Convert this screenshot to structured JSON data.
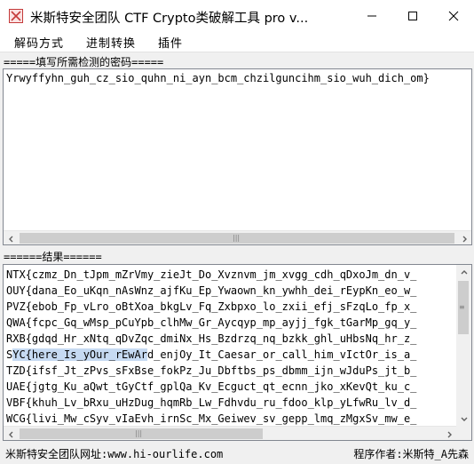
{
  "window": {
    "title": "米斯特安全团队 CTF Crypto类破解工具 pro v..."
  },
  "menu": {
    "items": [
      "解码方式",
      "进制转换",
      "插件"
    ]
  },
  "input_section": {
    "label": "=====填写所需检测的密码=====",
    "value": "Yrwyffyhn_guh_cz_sio_quhn_ni_ayn_bcm_chzilguncihm_sio_wuh_dich_om}"
  },
  "result_section": {
    "label": "======结果======",
    "lines": [
      {
        "pre": "NTX",
        "sel": "",
        "post": "{czmz_Dn_tJpm_mZrVmy_zieJt_Do_Xvznvm_jm_xvgg_cdh_qDxoJm_dn_v_"
      },
      {
        "pre": "OUY",
        "sel": "",
        "post": "{dana_Eo_uKqn_nAsWnz_ajfKu_Ep_Ywaown_kn_ywhh_dei_rEypKn_eo_w_"
      },
      {
        "pre": "PVZ",
        "sel": "",
        "post": "{ebob_Fp_vLro_oBtXoa_bkgLv_Fq_Zxbpxo_lo_zxii_efj_sFzqLo_fp_x_"
      },
      {
        "pre": "QWA",
        "sel": "",
        "post": "{fcpc_Gq_wMsp_pCuYpb_clhMw_Gr_Aycqyp_mp_ayjj_fgk_tGarMp_gq_y_"
      },
      {
        "pre": "RXB",
        "sel": "",
        "post": "{gdqd_Hr_xNtq_qDvZqc_dmiNx_Hs_Bzdrzq_nq_bzkk_ghl_uHbsNq_hr_z_"
      },
      {
        "pre": "S",
        "sel": "YC{here_Is_yOur_rEwAr",
        "post": "d_enjOy_It_Caesar_or_call_him_vIctOr_is_a_"
      },
      {
        "pre": "TZD",
        "sel": "",
        "post": "{ifsf_Jt_zPvs_sFxBse_fokPz_Ju_Dbftbs_ps_dbmm_ijn_wJduPs_jt_b_"
      },
      {
        "pre": "UAE",
        "sel": "",
        "post": "{jgtg_Ku_aQwt_tGyCtf_gplQa_Kv_Ecguct_qt_ecnn_jko_xKevQt_ku_c_"
      },
      {
        "pre": "VBF",
        "sel": "",
        "post": "{khuh_Lv_bRxu_uHzDug_hqmRb_Lw_Fdhvdu_ru_fdoo_klp_yLfwRu_lv_d_"
      },
      {
        "pre": "WCG",
        "sel": "",
        "post": "{livi_Mw_cSyv_vIaEvh_irnSc_Mx_Geiwev_sv_gepp_lmq_zMgxSv_mw_e_"
      }
    ]
  },
  "status": {
    "left": "米斯特安全团队网址:www.hi-ourlife.com",
    "right": "程序作者:米斯特_A先森"
  },
  "icons": {
    "app": "app-icon",
    "minimize": "minimize-icon",
    "maximize": "maximize-icon",
    "close": "close-icon"
  },
  "colors": {
    "selection": "#c6daf2",
    "border": "#828790"
  }
}
